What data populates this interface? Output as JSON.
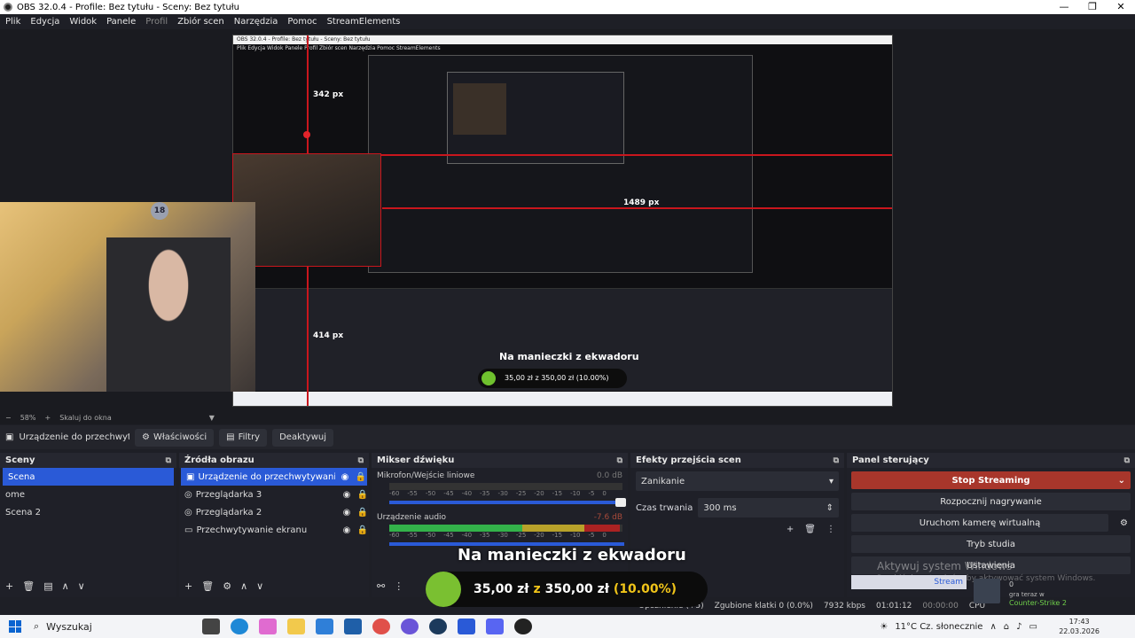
{
  "window": {
    "title": "OBS 32.0.4 - Profile: Bez tytułu - Sceny: Bez tytułu",
    "minimize": "—",
    "maximize": "❐",
    "close": "✕"
  },
  "menu": [
    "Plik",
    "Edycja",
    "Widok",
    "Panele",
    "Profil",
    "Zbiór scen",
    "Narzędzia",
    "Pomoc",
    "StreamElements"
  ],
  "preview": {
    "label_342": "342 px",
    "label_414": "414 px",
    "label_1489": "1489 px",
    "badge": "18",
    "inner_title": "OBS 32.0.4 - Profile: Bez tytułu - Sceny: Bez tytułu",
    "inner_menu": "Plik   Edycja   Widok   Panele   Profil   Zbiór scen   Narzędzia   Pomoc   StreamElements",
    "inner_overlay_title": "Na manieczki z ekwadoru",
    "inner_overlay_pill": "35,00 zł z 350,00 zł (10.00%)"
  },
  "zoom": {
    "minus": "−",
    "value": "58%",
    "plus": "+",
    "mode": "Skaluj do okna"
  },
  "source_toolbar": {
    "selected_source": "Urządzenie do przechwyt",
    "properties": "Właściwości",
    "filters": "Filtry",
    "deactivate": "Deaktywuj"
  },
  "scenes": {
    "title": "Sceny",
    "items": [
      "Scena",
      "ome",
      "Scena 2"
    ]
  },
  "sources": {
    "title": "Źródła obrazu",
    "items": [
      {
        "name": "Urządzenie do przechwytywania wideo",
        "icon": "camera-icon"
      },
      {
        "name": "Przeglądarka 3",
        "icon": "globe-icon"
      },
      {
        "name": "Przeglądarka 2",
        "icon": "globe-icon"
      },
      {
        "name": "Przechwytywanie ekranu",
        "icon": "monitor-icon"
      }
    ]
  },
  "mixer": {
    "title": "Mikser dźwięku",
    "channels": [
      {
        "name": "Mikrofon/Wejście liniowe",
        "db": "0.0 dB",
        "level": 0.0
      },
      {
        "name": "Urządzenie audio",
        "db": "-7.6 dB",
        "level": 0.55
      }
    ],
    "scale": [
      "-60",
      "-55",
      "-50",
      "-45",
      "-40",
      "-35",
      "-30",
      "-25",
      "-20",
      "-15",
      "-10",
      "-5",
      "0"
    ]
  },
  "transitions": {
    "title": "Efekty przejścia scen",
    "selected": "Zanikanie",
    "duration_label": "Czas trwania",
    "duration_value": "300 ms"
  },
  "controls": {
    "title": "Panel sterujący",
    "stop_streaming": "Stop Streaming",
    "start_recording": "Rozpocznij nagrywanie",
    "virtual_camera": "Uruchom kamerę wirtualną",
    "studio_mode": "Tryb studia",
    "settings": "Ustawienia",
    "stream_label": "Stream"
  },
  "status": {
    "delay": "Opóźnienie (+5)",
    "dropped": "Zgubione klatki 0 (0.0%)",
    "bitrate": "7932 kbps",
    "live_time": "01:01:12",
    "rec_time": "00:00:00",
    "cpu": "CPU"
  },
  "overlay": {
    "title": "Na manieczki z ekwadoru",
    "current": "35,00 zł",
    "separator": "z",
    "goal": "350,00 zł",
    "percent": "(10.00%)"
  },
  "watermark": {
    "line1": "Aktywuj system Windows",
    "line2": "Przejdź do ustawień, aby aktywować system Windows."
  },
  "stream_widget": {
    "playing": "gra teraz w",
    "game": "Counter-Strike 2",
    "count": "0"
  },
  "taskbar": {
    "search_placeholder": "Wyszukaj",
    "weather": "11°C  Cz. słonecznie",
    "time": "17:43",
    "date": "22.03.2026"
  }
}
